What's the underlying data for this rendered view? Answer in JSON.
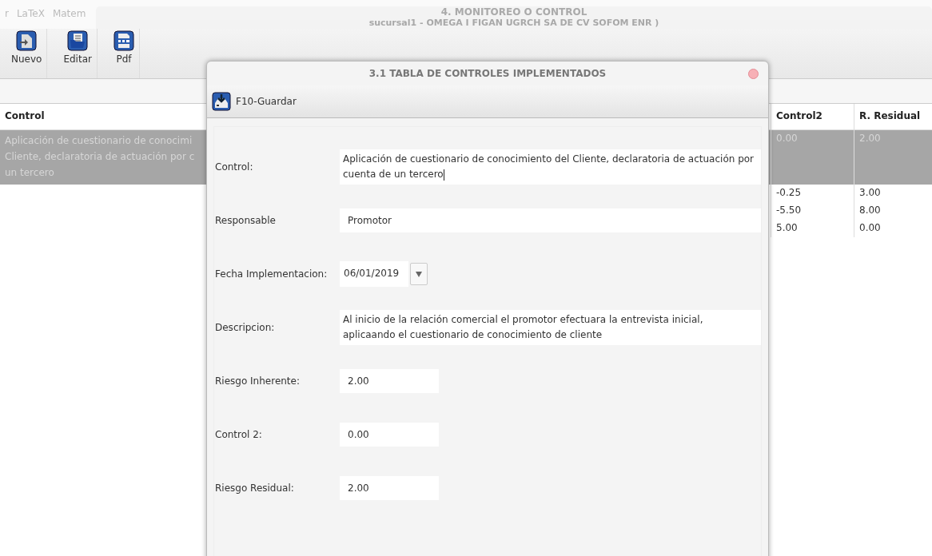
{
  "menu": [
    "r",
    "LaTeX",
    "Matem"
  ],
  "window": {
    "title": "4. MONITOREO O CONTROL",
    "subtitle": "sucursal1 - OMEGA I FIGAN UGRCH SA DE CV SOFOM ENR )"
  },
  "toolbar": [
    {
      "label": "Nuevo",
      "kind": "new"
    },
    {
      "label": "Editar",
      "kind": "edit"
    },
    {
      "label": "Pdf",
      "kind": "pdf"
    }
  ],
  "table": {
    "columns": [
      "Control",
      "Control2",
      "R. Residual"
    ],
    "rows": [
      {
        "selected": true,
        "control_lines": [
          "Aplicación de cuestionario de conocimi",
          "Cliente, declaratoria de actuación por c",
          "un tercero"
        ],
        "control2": "0.00",
        "residual": "2.00"
      },
      {
        "selected": false,
        "control_lines": [],
        "control2": "-0.25",
        "residual": "3.00"
      },
      {
        "selected": false,
        "control_lines": [],
        "control2": "-5.50",
        "residual": "8.00"
      },
      {
        "selected": false,
        "control_lines": [],
        "control2": "5.00",
        "residual": "0.00"
      }
    ]
  },
  "dialog": {
    "title": "3.1 TABLA DE CONTROLES IMPLEMENTADOS",
    "save_button": "F10-Guardar",
    "fields": [
      {
        "label": "Control:",
        "value": "Aplicación de cuestionario de conocimiento del Cliente, declaratoria de actuación por cuenta de un tercero",
        "kind": "textarea"
      },
      {
        "label": "Responsable",
        "value": "Promotor",
        "kind": "text"
      },
      {
        "label": "Fecha Implementacion:",
        "value": "06/01/2019",
        "kind": "date"
      },
      {
        "label": "Descripcion:",
        "value": "Al inicio de la relación comercial el promotor efectuara la entrevista inicial, aplicaando el cuestionario de conocimiento de cliente",
        "kind": "textarea"
      },
      {
        "label": "Riesgo Inherente:",
        "value": "2.00",
        "kind": "short"
      },
      {
        "label": "Control 2:",
        "value": "0.00",
        "kind": "short"
      },
      {
        "label": "Riesgo Residual:",
        "value": "2.00",
        "kind": "short"
      }
    ]
  }
}
